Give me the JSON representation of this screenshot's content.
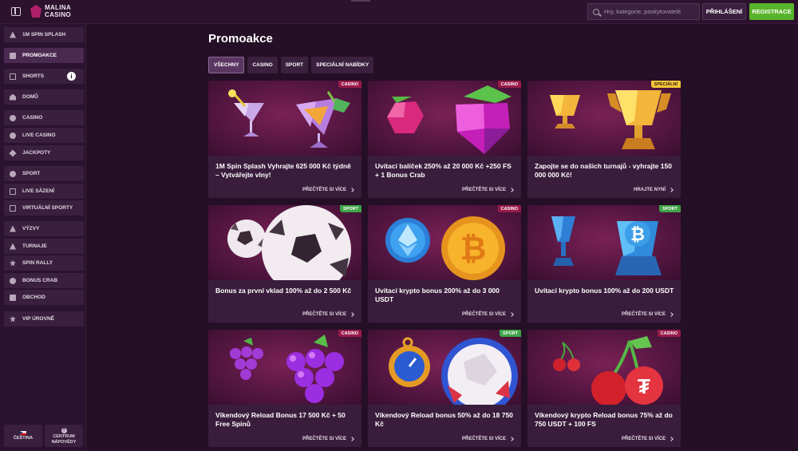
{
  "header": {
    "logo_line1": "MALINA",
    "logo_line2": "CASINO",
    "search_placeholder": "Hry, kategorie, poskytovatelé",
    "login_label": "PŘIHLÁŠENÍ",
    "register_label": "REGISTRACE"
  },
  "sidebar": {
    "items": [
      {
        "label": "1M SPIN SPLASH",
        "icon": "rocket-icon"
      },
      {
        "label": "PROMOAKCE",
        "icon": "gift-icon"
      },
      {
        "label": "SHORTS",
        "icon": "video-icon"
      },
      {
        "label": "DOMŮ",
        "icon": "home-icon"
      },
      {
        "label": "CASINO",
        "icon": "casino-chip-icon"
      },
      {
        "label": "LIVE CASINO",
        "icon": "live-casino-icon"
      },
      {
        "label": "JACKPOTY",
        "icon": "jackpot-icon"
      },
      {
        "label": "SPORT",
        "icon": "soccer-ball-icon"
      },
      {
        "label": "LIVE SÁZENÍ",
        "icon": "live-betting-icon"
      },
      {
        "label": "VIRTUÁLNÍ SPORTY",
        "icon": "virtual-sports-icon"
      },
      {
        "label": "VÝZVY",
        "icon": "trophy-icon"
      },
      {
        "label": "TURNAJE",
        "icon": "tournament-icon"
      },
      {
        "label": "SPIN RALLY",
        "icon": "spin-rally-icon"
      },
      {
        "label": "BONUS CRAB",
        "icon": "crab-icon"
      },
      {
        "label": "OBCHOD",
        "icon": "shop-icon"
      },
      {
        "label": "VIP ÚROVNĚ",
        "icon": "vip-star-icon"
      }
    ],
    "shorts_info": "i",
    "language_label": "ČEŠTINA",
    "help_label_1": "CENTRUM",
    "help_label_2": "NÁPOVĚDY"
  },
  "main": {
    "title": "Promoakce",
    "tabs": [
      {
        "label": "VŠECHNY",
        "active": true
      },
      {
        "label": "CASINO",
        "active": false
      },
      {
        "label": "SPORT",
        "active": false
      },
      {
        "label": "SPECIÁLNÍ NABÍDKY",
        "active": false
      }
    ],
    "cards": [
      {
        "badge": "CASINO",
        "title": "1M Spin Splash Vyhrajte 625 000 Kč týdně – Vytvářejte vlny!",
        "link": "PŘEČTĚTE SI VÍCE",
        "art": "cocktails"
      },
      {
        "badge": "CASINO",
        "title": "Uvítací balíček 250% až 20 000 Kč +250 FS + 1 Bonus Crab",
        "link": "PŘEČTĚTE SI VÍCE",
        "art": "raspberries"
      },
      {
        "badge": "SPECIÁLNÍ",
        "title": "Zapojte se do našich turnajů - vyhrajte 150 000 000 Kč!",
        "link": "HRAJTE NYNÍ",
        "art": "trophies"
      },
      {
        "badge": "SPORT",
        "title": "Bonus za první vklad 100% až do 2 500 Kč",
        "link": "PŘEČTĚTE SI VÍCE",
        "art": "soccer"
      },
      {
        "badge": "CASINO",
        "title": "Uvítací krypto bonus 200% až do 3 000 USDT",
        "link": "PŘEČTĚTE SI VÍCE",
        "art": "crypto-coins"
      },
      {
        "badge": "SPORT",
        "title": "Uvítací krypto bonus 100% až do 200 USDT",
        "link": "PŘEČTĚTE SI VÍCE",
        "art": "crypto-trophies"
      },
      {
        "badge": "CASINO",
        "title": "Víkendový Reload Bonus 17 500 Kč + 50 Free Spinů",
        "link": "PŘEČTĚTE SI VÍCE",
        "art": "grapes"
      },
      {
        "badge": "SPORT",
        "title": "Víkendový Reload bonus 50% až do 18 750 Kč",
        "link": "PŘEČTĚTE SI VÍCE",
        "art": "stopwatch-ball"
      },
      {
        "badge": "CASINO",
        "title": "Víkendový krypto Reload bonus 75% až do 750 USDT + 100 FS",
        "link": "PŘEČTĚTE SI VÍCE",
        "art": "cherries"
      }
    ]
  }
}
